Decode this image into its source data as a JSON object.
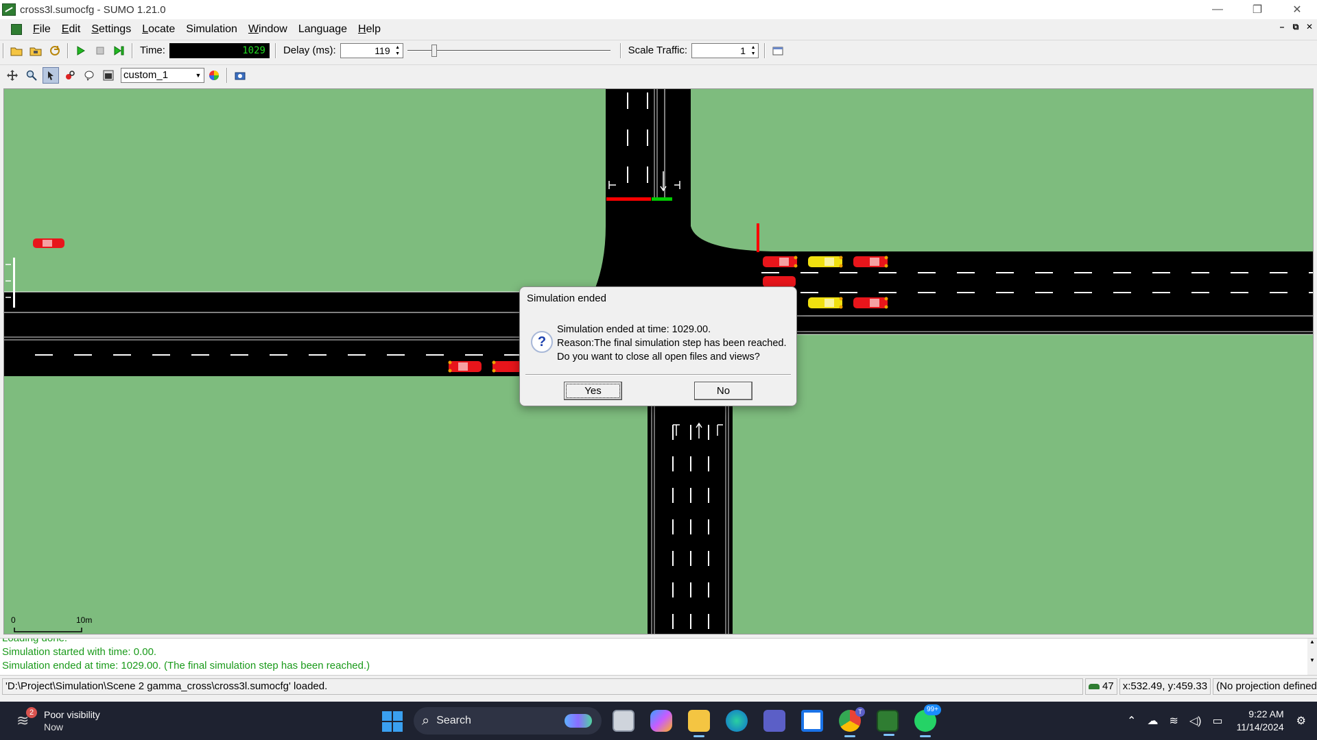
{
  "window": {
    "title": "cross3l.sumocfg - SUMO 1.21.0",
    "controls": [
      "—",
      "❐",
      "✕"
    ]
  },
  "menu": {
    "items": [
      {
        "label": "File",
        "u": "F",
        "rest": "ile"
      },
      {
        "label": "Edit",
        "u": "E",
        "rest": "dit"
      },
      {
        "label": "Settings",
        "u": "S",
        "rest": "ettings"
      },
      {
        "label": "Locate",
        "u": "L",
        "rest": "ocate"
      },
      {
        "label": "Simulation",
        "u": "S",
        "rest": "imulation",
        "nounderline": true
      },
      {
        "label": "Window",
        "u": "W",
        "rest": "indow"
      },
      {
        "label": "Language",
        "u": "",
        "rest": "Language"
      },
      {
        "label": "Help",
        "u": "H",
        "rest": "elp"
      }
    ],
    "mdi_controls": [
      "–",
      "⧉",
      "✕"
    ]
  },
  "toolbar": {
    "time_label": "Time:",
    "time_value": "1029",
    "delay_label": "Delay (ms):",
    "delay_value": "119",
    "delay_slider_fraction": 0.12,
    "scale_label": "Scale Traffic:",
    "scale_value": "1"
  },
  "view_toolbar": {
    "scheme": "custom_1"
  },
  "canvas": {
    "scale_zero": "0",
    "scale_label": "10m"
  },
  "messages": {
    "lines": [
      "Loading done.",
      "Simulation started with time: 0.00.",
      "Simulation ended at time: 1029.00. (The final simulation step has been reached.)"
    ]
  },
  "status": {
    "path": "'D:\\Project\\Simulation\\Scene 2 gamma_cross\\cross3l.sumocfg' loaded.",
    "vehicle_count": "47",
    "coords": "x:532.49, y:459.33",
    "projection": "(No projection defined)"
  },
  "dialog": {
    "title": "Simulation ended",
    "line1": "Simulation ended at time: 1029.00.",
    "line2": "Reason:The final simulation step has been reached.",
    "line3": "Do you want to close all open files and views?",
    "yes": "Yes",
    "no": "No"
  },
  "taskbar": {
    "weather_badge": "2",
    "weather_title": "Poor visibility",
    "weather_sub": "Now",
    "search_label": "Search",
    "whatsapp_badge": "99+",
    "teams_badge": "T",
    "time": "9:22 AM",
    "date": "11/14/2024"
  },
  "colors": {
    "grass": "#7ebc7e",
    "road": "#000000",
    "vehicle_red": "#e8151b",
    "vehicle_yellow": "#f0e010",
    "signal_red": "#ff0000",
    "signal_green": "#00cc00",
    "message_green": "#1a9a1a"
  }
}
